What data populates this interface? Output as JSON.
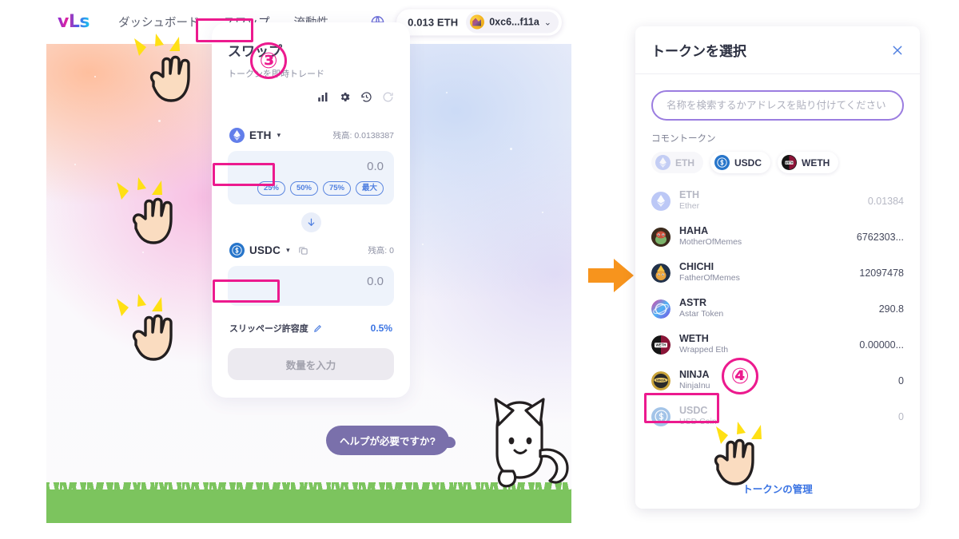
{
  "app": {
    "brand": "vLs",
    "nav": [
      {
        "label": "ダッシュボード"
      },
      {
        "label": "スワップ"
      },
      {
        "label": "流動性"
      }
    ],
    "header": {
      "globe_icon": "globe-icon",
      "eth_balance": "0.013 ETH",
      "account_address": "0xc6...f11a",
      "account_caret": "⌄"
    }
  },
  "swap_card": {
    "title": "スワップ",
    "subtitle": "トークンを即時トレード",
    "tools": [
      {
        "name": "chart-icon"
      },
      {
        "name": "settings-gear-icon"
      },
      {
        "name": "history-clock-icon"
      },
      {
        "name": "refresh-icon"
      }
    ],
    "pay": {
      "token_symbol": "ETH",
      "caret": "▾",
      "balance_label": "残高: 0.0138387",
      "amount": "0.0",
      "percent_buttons": [
        "25%",
        "50%",
        "75%",
        "最大"
      ]
    },
    "switch_icon": "swap-direction-arrow-icon",
    "receive": {
      "token_symbol": "USDC",
      "caret": "▾",
      "copy_icon": "copy-icon",
      "balance_label": "残高: 0",
      "amount": "0.0"
    },
    "slippage": {
      "label": "スリッページ許容度",
      "edit_icon": "pencil-icon",
      "value": "0.5%"
    },
    "submit_label": "数量を入力"
  },
  "help": {
    "bubble_text": "ヘルプが必要ですか?"
  },
  "token_panel": {
    "title": "トークンを選択",
    "close_icon": "close-icon",
    "search_placeholder": "名称を検索するかアドレスを貼り付けてください",
    "search_value": "",
    "common_label": "コモントークン",
    "common_tokens": [
      {
        "symbol": "ETH",
        "disabled": true
      },
      {
        "symbol": "USDC",
        "disabled": false
      },
      {
        "symbol": "WETH",
        "disabled": false
      }
    ],
    "tokens": [
      {
        "symbol": "ETH",
        "name": "Ether",
        "balance": "0.01384",
        "dim": true
      },
      {
        "symbol": "HAHA",
        "name": "MotherOfMemes",
        "balance": "6762303...",
        "dim": false
      },
      {
        "symbol": "CHICHI",
        "name": "FatherOfMemes",
        "balance": "12097478",
        "dim": false
      },
      {
        "symbol": "ASTR",
        "name": "Astar Token",
        "balance": "290.8",
        "dim": false
      },
      {
        "symbol": "WETH",
        "name": "Wrapped Eth",
        "balance": "0.00000...",
        "dim": false
      },
      {
        "symbol": "NINJA",
        "name": "NinjaInu",
        "balance": "0",
        "dim": false
      },
      {
        "symbol": "USDC",
        "name": "USD Coin",
        "balance": "0",
        "dim": true
      }
    ],
    "manage_label": "トークンの管理"
  },
  "annotations": {
    "step3": "③",
    "step4": "④",
    "accent_color": "#ec1a8e",
    "flow_arrow_color": "#f7941d"
  }
}
